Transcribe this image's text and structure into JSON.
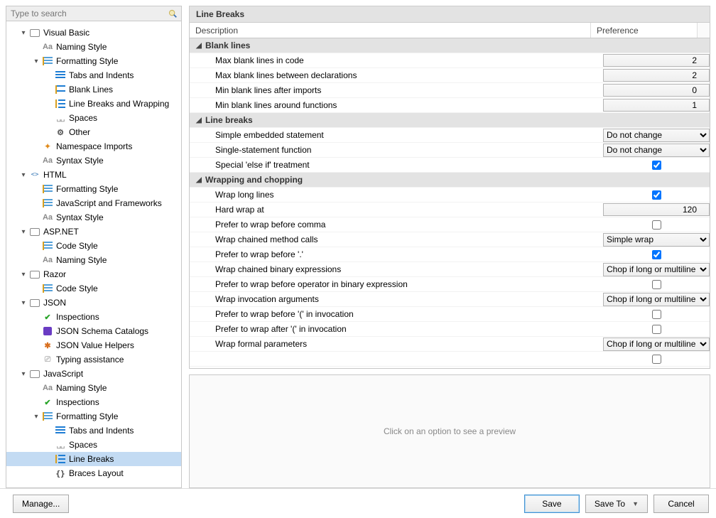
{
  "search": {
    "placeholder": "Type to search"
  },
  "title": "Line Breaks",
  "columns": {
    "desc": "Description",
    "pref": "Preference"
  },
  "preview_hint": "Click on an option to see a preview",
  "buttons": {
    "manage": "Manage...",
    "save": "Save",
    "save_to": "Save To",
    "cancel": "Cancel"
  },
  "tree": [
    {
      "label": "Visual Basic",
      "depth": 0,
      "expand": "open",
      "icon": "lang"
    },
    {
      "label": "Naming Style",
      "depth": 1,
      "expand": "none",
      "icon": "Aa"
    },
    {
      "label": "Formatting Style",
      "depth": 1,
      "expand": "open",
      "icon": "lines"
    },
    {
      "label": "Tabs and Indents",
      "depth": 2,
      "expand": "none",
      "icon": "indent"
    },
    {
      "label": "Blank Lines",
      "depth": 2,
      "expand": "none",
      "icon": "blank"
    },
    {
      "label": "Line Breaks and Wrapping",
      "depth": 2,
      "expand": "none",
      "icon": "wrap"
    },
    {
      "label": "Spaces",
      "depth": 2,
      "expand": "none",
      "icon": "spaces"
    },
    {
      "label": "Other",
      "depth": 2,
      "expand": "none",
      "icon": "gear"
    },
    {
      "label": "Namespace Imports",
      "depth": 1,
      "expand": "none",
      "icon": "ns"
    },
    {
      "label": "Syntax Style",
      "depth": 1,
      "expand": "none",
      "icon": "Aa"
    },
    {
      "label": "HTML",
      "depth": 0,
      "expand": "open",
      "icon": "html"
    },
    {
      "label": "Formatting Style",
      "depth": 1,
      "expand": "none",
      "icon": "lines"
    },
    {
      "label": "JavaScript and Frameworks",
      "depth": 1,
      "expand": "none",
      "icon": "lines"
    },
    {
      "label": "Syntax Style",
      "depth": 1,
      "expand": "none",
      "icon": "Aa"
    },
    {
      "label": "ASP.NET",
      "depth": 0,
      "expand": "open",
      "icon": "lang"
    },
    {
      "label": "Code Style",
      "depth": 1,
      "expand": "none",
      "icon": "lines"
    },
    {
      "label": "Naming Style",
      "depth": 1,
      "expand": "none",
      "icon": "Aa"
    },
    {
      "label": "Razor",
      "depth": 0,
      "expand": "open",
      "icon": "lang"
    },
    {
      "label": "Code Style",
      "depth": 1,
      "expand": "none",
      "icon": "lines"
    },
    {
      "label": "JSON",
      "depth": 0,
      "expand": "open",
      "icon": "lang"
    },
    {
      "label": "Inspections",
      "depth": 1,
      "expand": "none",
      "icon": "check"
    },
    {
      "label": "JSON Schema Catalogs",
      "depth": 1,
      "expand": "none",
      "icon": "schema"
    },
    {
      "label": "JSON Value Helpers",
      "depth": 1,
      "expand": "none",
      "icon": "helper"
    },
    {
      "label": "Typing assistance",
      "depth": 1,
      "expand": "none",
      "icon": "typing"
    },
    {
      "label": "JavaScript",
      "depth": 0,
      "expand": "open",
      "icon": "lang"
    },
    {
      "label": "Naming Style",
      "depth": 1,
      "expand": "none",
      "icon": "Aa"
    },
    {
      "label": "Inspections",
      "depth": 1,
      "expand": "none",
      "icon": "check"
    },
    {
      "label": "Formatting Style",
      "depth": 1,
      "expand": "open",
      "icon": "lines"
    },
    {
      "label": "Tabs and Indents",
      "depth": 2,
      "expand": "none",
      "icon": "indent"
    },
    {
      "label": "Spaces",
      "depth": 2,
      "expand": "none",
      "icon": "spaces"
    },
    {
      "label": "Line Breaks",
      "depth": 2,
      "expand": "none",
      "icon": "wrap",
      "selected": true
    },
    {
      "label": "Braces Layout",
      "depth": 2,
      "expand": "none",
      "icon": "braces"
    }
  ],
  "rows": [
    {
      "kind": "category",
      "label": "Blank lines"
    },
    {
      "kind": "number",
      "label": "Max blank lines in code",
      "value": 2
    },
    {
      "kind": "number",
      "label": "Max blank lines between declarations",
      "value": 2
    },
    {
      "kind": "number",
      "label": "Min blank lines after imports",
      "value": 0
    },
    {
      "kind": "number",
      "label": "Min blank lines around functions",
      "value": 1
    },
    {
      "kind": "category",
      "label": "Line breaks"
    },
    {
      "kind": "select",
      "label": "Simple embedded statement",
      "value": "Do not change"
    },
    {
      "kind": "select",
      "label": "Single-statement function",
      "value": "Do not change"
    },
    {
      "kind": "checkbox",
      "label": "Special 'else if' treatment",
      "value": true
    },
    {
      "kind": "category",
      "label": "Wrapping and chopping"
    },
    {
      "kind": "checkbox",
      "label": "Wrap long lines",
      "value": true
    },
    {
      "kind": "number",
      "label": "Hard wrap at",
      "value": 120
    },
    {
      "kind": "checkbox",
      "label": "Prefer to wrap before comma",
      "value": false
    },
    {
      "kind": "select",
      "label": "Wrap chained method calls",
      "value": "Simple wrap"
    },
    {
      "kind": "checkbox",
      "label": "Prefer to wrap before '.'",
      "value": true
    },
    {
      "kind": "select",
      "label": "Wrap chained binary expressions",
      "value": "Chop if long or multiline"
    },
    {
      "kind": "checkbox",
      "label": "Prefer to wrap before operator in binary expression",
      "value": false
    },
    {
      "kind": "select",
      "label": "Wrap invocation arguments",
      "value": "Chop if long or multiline"
    },
    {
      "kind": "checkbox",
      "label": "Prefer to wrap before '(' in invocation",
      "value": false
    },
    {
      "kind": "checkbox",
      "label": "Prefer to wrap after '(' in invocation",
      "value": false
    },
    {
      "kind": "select",
      "label": "Wrap formal parameters",
      "value": "Chop if long or multiline"
    },
    {
      "kind": "checkbox",
      "label": " ",
      "value": false
    }
  ],
  "select_options": [
    "Do not change",
    "Simple wrap",
    "Chop if long or multiline"
  ]
}
